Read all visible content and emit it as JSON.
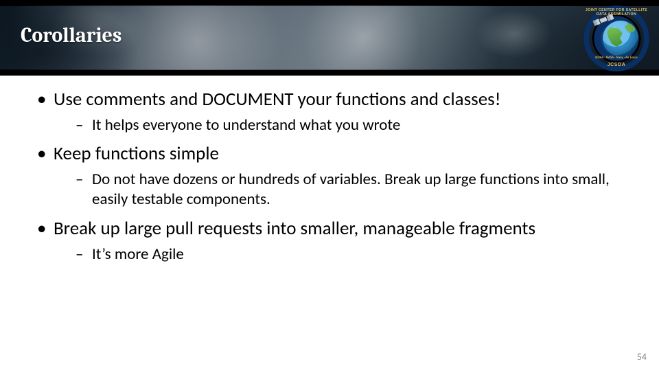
{
  "header": {
    "title": "Corollaries",
    "logo": {
      "top_text": "JOINT CENTER FOR SATELLITE DATA ASSIMILATION",
      "bottom_text": "JCSDA",
      "agencies_text": "NOAA · NASA · Navy · Air Force"
    }
  },
  "bullets": [
    {
      "text": "Use comments and DOCUMENT your functions and classes!",
      "sub": [
        {
          "text": "It helps everyone to understand what you wrote"
        }
      ]
    },
    {
      "text": "Keep functions simple",
      "sub": [
        {
          "text": "Do not have dozens or hundreds of variables. Break up large functions into small, easily testable components."
        }
      ]
    },
    {
      "text": "Break up large pull requests into smaller, manageable fragments",
      "sub": [
        {
          "text": "It’s more Agile"
        }
      ]
    }
  ],
  "page_number": "54"
}
